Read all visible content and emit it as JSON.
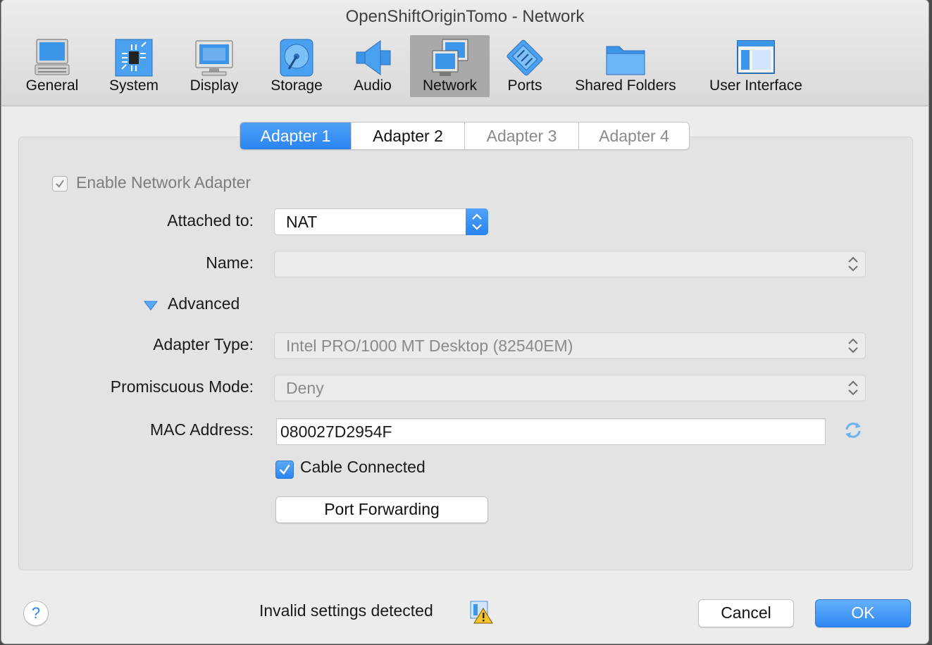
{
  "window": {
    "title": "OpenShiftOriginTomo - Network"
  },
  "toolbar": {
    "items": [
      {
        "label": "General",
        "icon": "general-icon"
      },
      {
        "label": "System",
        "icon": "system-icon"
      },
      {
        "label": "Display",
        "icon": "display-icon"
      },
      {
        "label": "Storage",
        "icon": "storage-icon"
      },
      {
        "label": "Audio",
        "icon": "audio-icon"
      },
      {
        "label": "Network",
        "icon": "network-icon",
        "selected": true
      },
      {
        "label": "Ports",
        "icon": "ports-icon"
      },
      {
        "label": "Shared Folders",
        "icon": "shared-folders-icon"
      },
      {
        "label": "User Interface",
        "icon": "user-interface-icon"
      }
    ]
  },
  "tabs": [
    {
      "label": "Adapter 1",
      "state": "active"
    },
    {
      "label": "Adapter 2",
      "state": "enabled"
    },
    {
      "label": "Adapter 3",
      "state": "disabled"
    },
    {
      "label": "Adapter 4",
      "state": "disabled"
    }
  ],
  "form": {
    "enable_adapter": {
      "label": "Enable Network Adapter",
      "checked": true
    },
    "attached_to": {
      "label": "Attached to:",
      "value": "NAT"
    },
    "name": {
      "label": "Name:",
      "value": ""
    },
    "advanced": {
      "label": "Advanced",
      "expanded": true
    },
    "adapter_type": {
      "label": "Adapter Type:",
      "value": "Intel PRO/1000 MT Desktop (82540EM)"
    },
    "promiscuous_mode": {
      "label": "Promiscuous Mode:",
      "value": "Deny"
    },
    "mac_address": {
      "label": "MAC Address:",
      "value": "080027D2954F"
    },
    "cable_connected": {
      "label": "Cable Connected",
      "checked": true
    },
    "port_forwarding": {
      "label": "Port Forwarding"
    }
  },
  "footer": {
    "help_label": "?",
    "status": "Invalid settings detected",
    "cancel": "Cancel",
    "ok": "OK"
  },
  "colors": {
    "accent": "#2a84f0",
    "panel": "#e3e3e3",
    "window": "#ececec"
  }
}
